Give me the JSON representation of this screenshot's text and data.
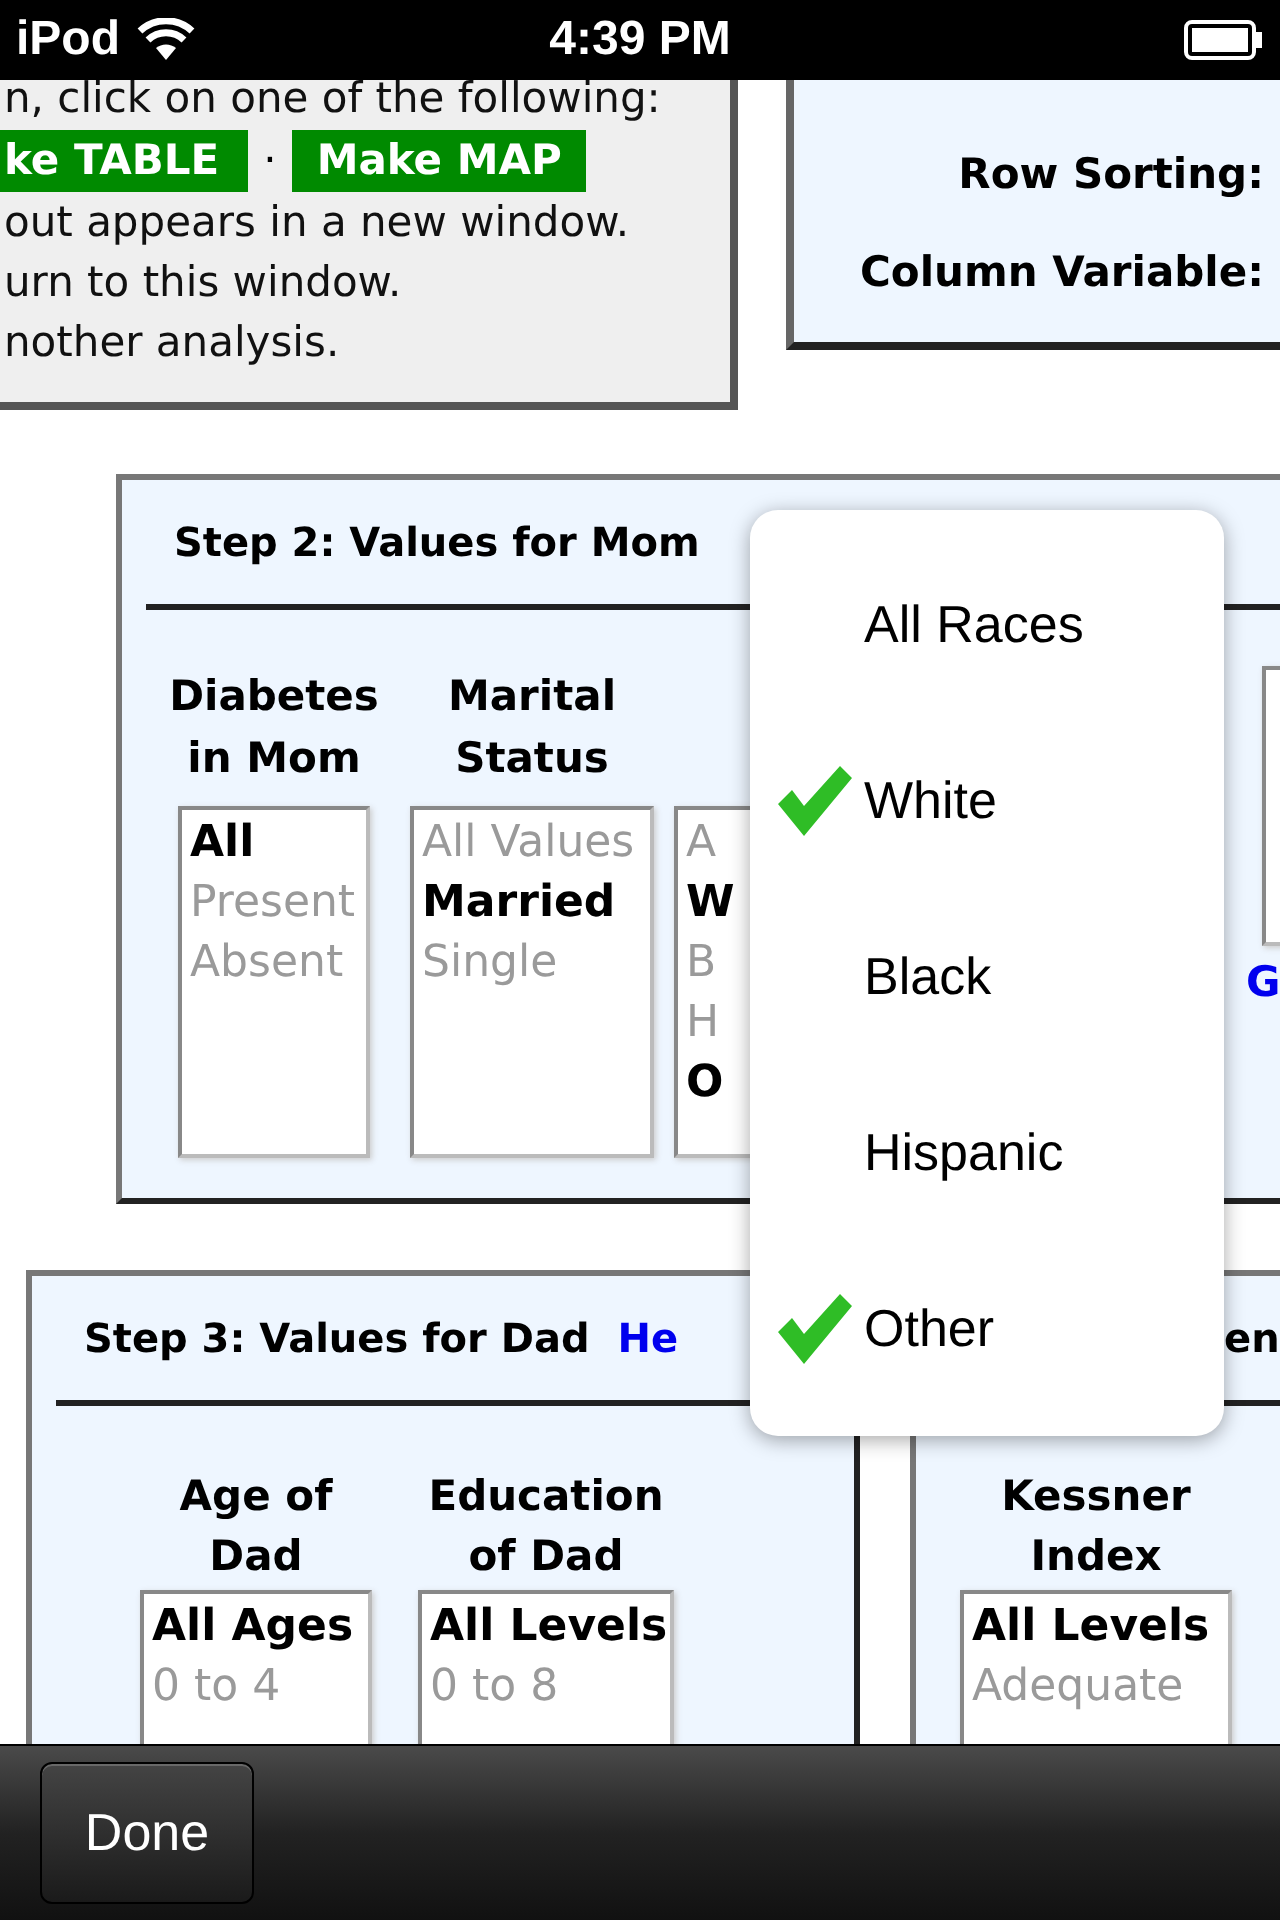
{
  "status_bar": {
    "carrier": "iPod",
    "time": "4:39 PM"
  },
  "intro_panel": {
    "first_line": "n, click on one of the following:",
    "buttons": [
      "ke TABLE",
      "Make MAP"
    ],
    "separator": "·",
    "lines": [
      "out appears in a new window.",
      "urn to this window.",
      "nother analysis."
    ]
  },
  "table_panel": {
    "labels": [
      "Row Sorting:",
      "Column Variable:"
    ]
  },
  "step2": {
    "title": "Step 2: Values for Mom",
    "columns": [
      {
        "heading": "Diabetes in Mom",
        "options": [
          {
            "label": "All",
            "selected": true
          },
          {
            "label": "Present",
            "selected": false
          },
          {
            "label": "Absent",
            "selected": false
          }
        ]
      },
      {
        "heading": "Marital Status",
        "options": [
          {
            "label": "All Values",
            "selected": false
          },
          {
            "label": "Married",
            "selected": true
          },
          {
            "label": "Single",
            "selected": false
          }
        ]
      },
      {
        "options": [
          {
            "label": "A",
            "selected": false
          },
          {
            "label": "W",
            "selected": true
          },
          {
            "label": "B",
            "selected": false
          },
          {
            "label": "H",
            "selected": false
          },
          {
            "label": "O",
            "selected": true
          }
        ]
      }
    ],
    "link": "G"
  },
  "step3": {
    "title": "Step 3: Values for Dad",
    "link": "He",
    "columns": [
      {
        "heading": "Age of Dad",
        "options": [
          {
            "label": "All Ages",
            "selected": true
          },
          {
            "label": "0 to 4",
            "selected": false
          }
        ]
      },
      {
        "heading": "Education of Dad",
        "options": [
          {
            "label": "All Levels",
            "selected": true
          },
          {
            "label": "0 to 8",
            "selected": false
          }
        ]
      }
    ]
  },
  "index_panel": {
    "title": "en",
    "columns": [
      {
        "heading": "Kessner Index",
        "options": [
          {
            "label": "All Levels",
            "selected": true
          },
          {
            "label": "Adequate",
            "selected": false
          }
        ]
      }
    ]
  },
  "race_picker": {
    "options": [
      {
        "label": "All Races",
        "checked": false
      },
      {
        "label": "White",
        "checked": true
      },
      {
        "label": "Black",
        "checked": false
      },
      {
        "label": "Hispanic",
        "checked": false
      },
      {
        "label": "Other",
        "checked": true
      }
    ]
  },
  "toolbar": {
    "done_button": "Done"
  }
}
